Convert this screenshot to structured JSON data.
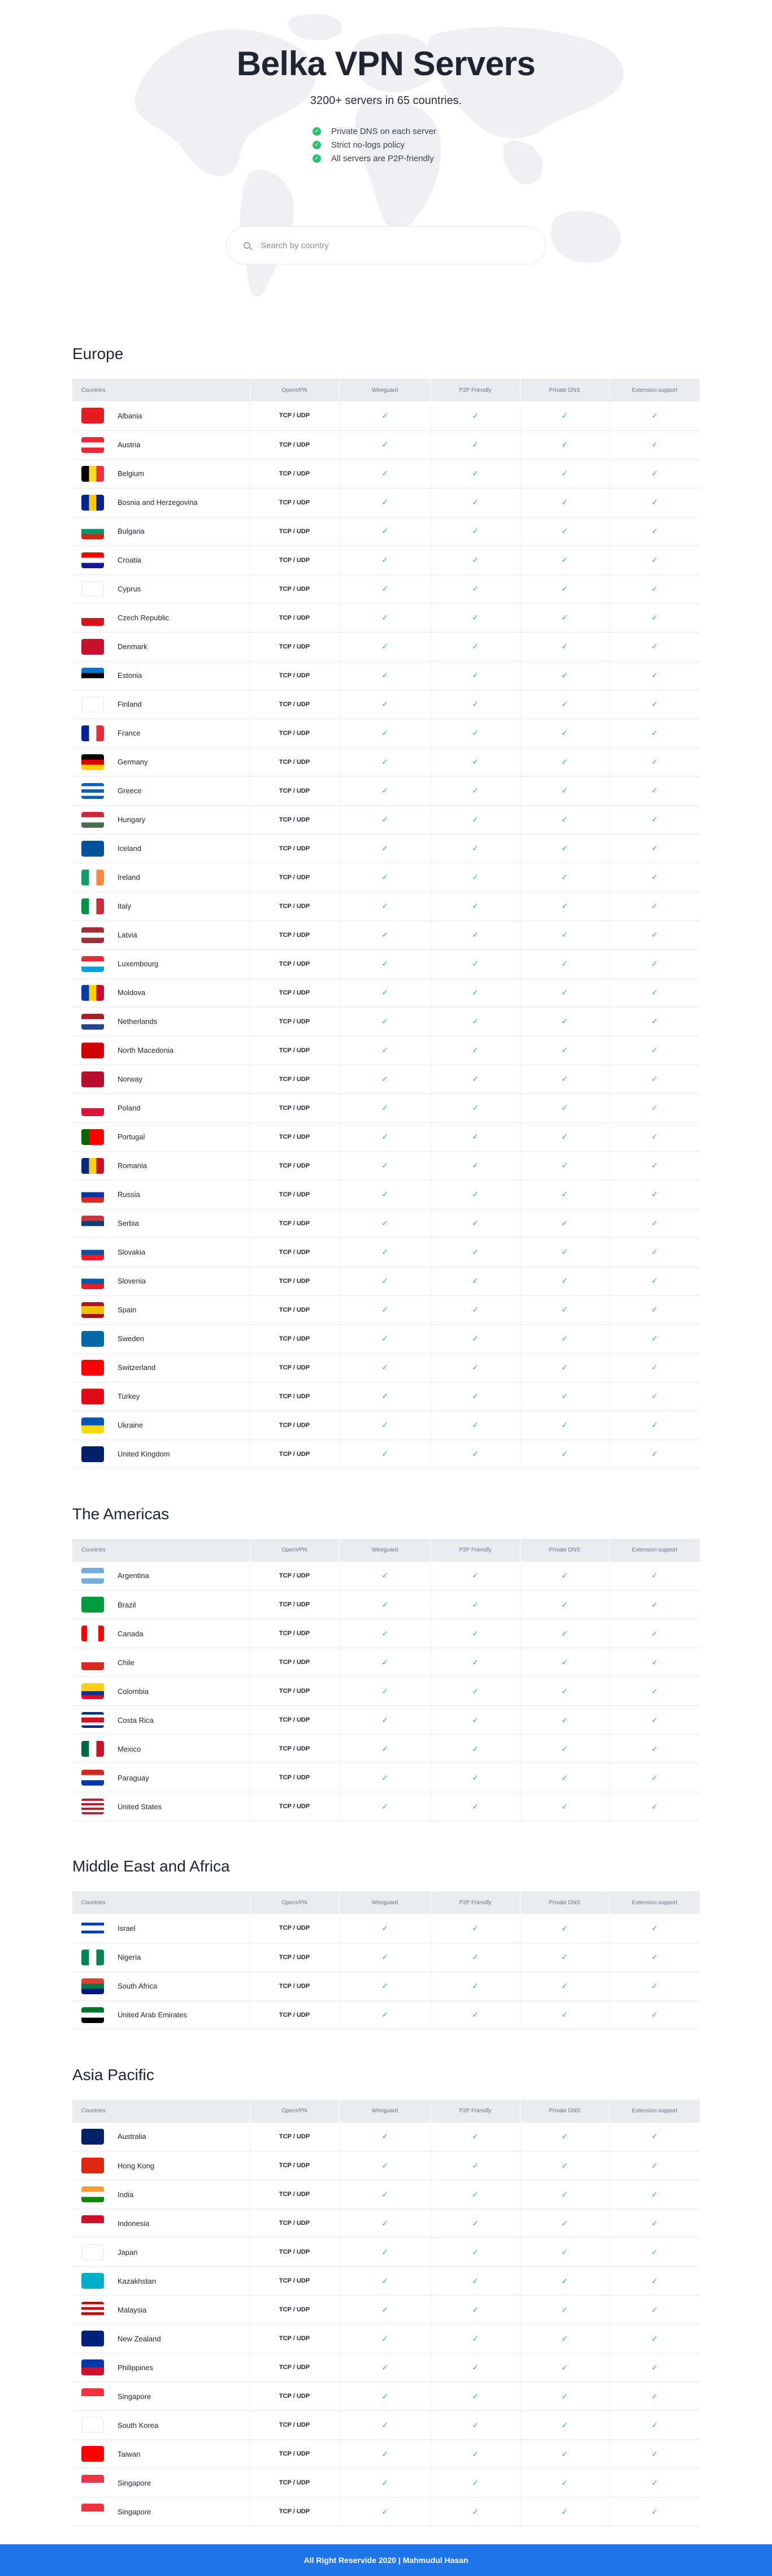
{
  "hero": {
    "title": "Belka VPN Servers",
    "subtitle": "3200+ servers in 65 countries.",
    "features": [
      "Private DNS on each server",
      "Strict no-logs policy",
      "All servers are P2P-friendly"
    ]
  },
  "search": {
    "placeholder": "Search by country"
  },
  "table_headers": [
    "Countries",
    "OpenVPN",
    "Wireguard",
    "P2P Friendly",
    "Private DNS",
    "Extension support"
  ],
  "protocol_label": "TCP / UDP",
  "colors": {
    "accent": "#1f75ea",
    "check": "#2bc26b",
    "header_bg": "#e8ebf0"
  },
  "regions": [
    {
      "title": "Europe",
      "countries": [
        {
          "name": "Albania",
          "flag": [
            "#e41e20"
          ]
        },
        {
          "name": "Austria",
          "flag": [
            "#ed2939",
            "#ffffff",
            "#ed2939"
          ]
        },
        {
          "name": "Belgium",
          "flag": [
            "#000000",
            "#fdda24",
            "#ef3340"
          ],
          "dir": "v"
        },
        {
          "name": "Bosnia and Herzegovina",
          "flag": [
            "#002395",
            "#fecb00",
            "#002395"
          ],
          "dir": "v"
        },
        {
          "name": "Bulgaria",
          "flag": [
            "#ffffff",
            "#00966e",
            "#d62612"
          ]
        },
        {
          "name": "Croatia",
          "flag": [
            "#ff0000",
            "#ffffff",
            "#171796"
          ]
        },
        {
          "name": "Cyprus",
          "flag": [
            "#ffffff"
          ]
        },
        {
          "name": "Czech Republic",
          "flag": [
            "#ffffff",
            "#d7141a"
          ]
        },
        {
          "name": "Denmark",
          "flag": [
            "#c8102e"
          ]
        },
        {
          "name": "Estonia",
          "flag": [
            "#0072ce",
            "#000000",
            "#ffffff"
          ]
        },
        {
          "name": "Finland",
          "flag": [
            "#ffffff"
          ]
        },
        {
          "name": "France",
          "flag": [
            "#002395",
            "#ffffff",
            "#ed2939"
          ],
          "dir": "v"
        },
        {
          "name": "Germany",
          "flag": [
            "#000000",
            "#dd0000",
            "#ffce00"
          ]
        },
        {
          "name": "Greece",
          "flag": [
            "#0d5eaf",
            "#ffffff",
            "#0d5eaf",
            "#ffffff",
            "#0d5eaf"
          ]
        },
        {
          "name": "Hungary",
          "flag": [
            "#ce2939",
            "#ffffff",
            "#477050"
          ]
        },
        {
          "name": "Iceland",
          "flag": [
            "#02529c"
          ]
        },
        {
          "name": "Ireland",
          "flag": [
            "#169b62",
            "#ffffff",
            "#ff883e"
          ],
          "dir": "v"
        },
        {
          "name": "Italy",
          "flag": [
            "#009246",
            "#ffffff",
            "#ce2b37"
          ],
          "dir": "v"
        },
        {
          "name": "Latvia",
          "flag": [
            "#9e3039",
            "#ffffff",
            "#9e3039"
          ]
        },
        {
          "name": "Luxembourg",
          "flag": [
            "#ed2939",
            "#ffffff",
            "#00a1de"
          ]
        },
        {
          "name": "Moldova",
          "flag": [
            "#003da5",
            "#ffd200",
            "#cc092f"
          ],
          "dir": "v"
        },
        {
          "name": "Netherlands",
          "flag": [
            "#ae1c28",
            "#ffffff",
            "#21468b"
          ]
        },
        {
          "name": "North Macedonia",
          "flag": [
            "#d20000"
          ]
        },
        {
          "name": "Norway",
          "flag": [
            "#ba0c2f"
          ]
        },
        {
          "name": "Poland",
          "flag": [
            "#ffffff",
            "#dc143c"
          ]
        },
        {
          "name": "Portugal",
          "flag": [
            "#006600",
            "#ff0000",
            "#ff0000"
          ],
          "dir": "v"
        },
        {
          "name": "Romania",
          "flag": [
            "#002b7f",
            "#fcd116",
            "#ce1126"
          ],
          "dir": "v"
        },
        {
          "name": "Russia",
          "flag": [
            "#ffffff",
            "#0039a6",
            "#d52b1e"
          ]
        },
        {
          "name": "Serbia",
          "flag": [
            "#c6363c",
            "#0c4076",
            "#ffffff"
          ]
        },
        {
          "name": "Slovakia",
          "flag": [
            "#ffffff",
            "#0b4ea2",
            "#ee1c25"
          ]
        },
        {
          "name": "Slovenia",
          "flag": [
            "#ffffff",
            "#005da4",
            "#ed1c24"
          ]
        },
        {
          "name": "Spain",
          "flag": [
            "#aa151b",
            "#f1bf00",
            "#f1bf00",
            "#aa151b"
          ]
        },
        {
          "name": "Sweden",
          "flag": [
            "#006aa7"
          ]
        },
        {
          "name": "Switzerland",
          "flag": [
            "#ff0000"
          ]
        },
        {
          "name": "Turkey",
          "flag": [
            "#e30a17"
          ]
        },
        {
          "name": "Ukraine",
          "flag": [
            "#0057b7",
            "#ffd700"
          ]
        },
        {
          "name": "United Kingdom",
          "flag": [
            "#012169"
          ]
        }
      ]
    },
    {
      "title": "The Americas",
      "countries": [
        {
          "name": "Argentina",
          "flag": [
            "#74acdf",
            "#ffffff",
            "#74acdf"
          ]
        },
        {
          "name": "Brazil",
          "flag": [
            "#009c3b"
          ]
        },
        {
          "name": "Canada",
          "flag": [
            "#ff0000",
            "#ffffff",
            "#ffffff",
            "#ff0000"
          ],
          "dir": "v"
        },
        {
          "name": "Chile",
          "flag": [
            "#ffffff",
            "#d52b1e"
          ]
        },
        {
          "name": "Colombia",
          "flag": [
            "#fcd116",
            "#fcd116",
            "#003893",
            "#ce1126"
          ]
        },
        {
          "name": "Costa Rica",
          "flag": [
            "#002b7f",
            "#ffffff",
            "#ce1126",
            "#ce1126",
            "#ffffff",
            "#002b7f"
          ]
        },
        {
          "name": "Mexico",
          "flag": [
            "#006847",
            "#ffffff",
            "#ce1126"
          ],
          "dir": "v"
        },
        {
          "name": "Paraguay",
          "flag": [
            "#d52b1e",
            "#ffffff",
            "#0038a8"
          ]
        },
        {
          "name": "United States",
          "flag": [
            "#b22234",
            "#ffffff",
            "#b22234",
            "#ffffff",
            "#b22234",
            "#ffffff",
            "#b22234"
          ]
        }
      ]
    },
    {
      "title": "Middle East and Africa",
      "countries": [
        {
          "name": "Israel",
          "flag": [
            "#ffffff",
            "#0038b8",
            "#ffffff",
            "#ffffff",
            "#0038b8",
            "#ffffff"
          ]
        },
        {
          "name": "Nigeria",
          "flag": [
            "#008751",
            "#ffffff",
            "#008751"
          ],
          "dir": "v"
        },
        {
          "name": "South Africa",
          "flag": [
            "#e03c31",
            "#007749",
            "#001489"
          ]
        },
        {
          "name": "United Arab Emirates",
          "flag": [
            "#00732f",
            "#ffffff",
            "#000000"
          ]
        }
      ]
    },
    {
      "title": "Asia Pacific",
      "countries": [
        {
          "name": "Australia",
          "flag": [
            "#012169"
          ]
        },
        {
          "name": "Hong Kong",
          "flag": [
            "#de2910"
          ]
        },
        {
          "name": "India",
          "flag": [
            "#ff9933",
            "#ffffff",
            "#138808"
          ]
        },
        {
          "name": "Indonesia",
          "flag": [
            "#ce1126",
            "#ffffff"
          ]
        },
        {
          "name": "Japan",
          "flag": [
            "#ffffff"
          ]
        },
        {
          "name": "Kazakhstan",
          "flag": [
            "#00afca"
          ]
        },
        {
          "name": "Malaysia",
          "flag": [
            "#cc0001",
            "#ffffff",
            "#cc0001",
            "#ffffff",
            "#cc0001",
            "#ffffff"
          ]
        },
        {
          "name": "New Zealand",
          "flag": [
            "#00247d"
          ]
        },
        {
          "name": "Philippines",
          "flag": [
            "#0038a8",
            "#ce1126"
          ]
        },
        {
          "name": "Singapore",
          "flag": [
            "#ef3340",
            "#ffffff"
          ]
        },
        {
          "name": "South Korea",
          "flag": [
            "#ffffff"
          ]
        },
        {
          "name": "Taiwan",
          "flag": [
            "#fe0000"
          ]
        },
        {
          "name": "Singapore",
          "flag": [
            "#ef3340",
            "#ffffff"
          ]
        },
        {
          "name": "Singapore",
          "flag": [
            "#ef3340",
            "#ffffff"
          ]
        }
      ]
    }
  ],
  "footer": {
    "text": "All Right Reservide 2020 | Mahmudul Hasan"
  }
}
